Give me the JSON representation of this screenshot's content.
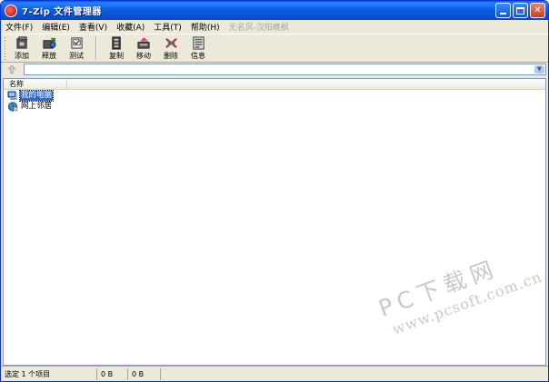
{
  "window": {
    "title": "7-Zip 文件管理器"
  },
  "menubar": {
    "items": [
      "文件(F)",
      "编辑(E)",
      "查看(V)",
      "收藏(A)",
      "工具(T)",
      "帮助(H)"
    ],
    "watermark": "无名风-汉阳晚枫"
  },
  "toolbar": {
    "buttons": [
      {
        "label": "添加",
        "icon": "add-icon"
      },
      {
        "label": "释放",
        "icon": "extract-icon"
      },
      {
        "label": "测试",
        "icon": "test-icon"
      },
      {
        "label": "复制",
        "icon": "copy-icon"
      },
      {
        "label": "移动",
        "icon": "move-icon"
      },
      {
        "label": "删除",
        "icon": "delete-icon"
      },
      {
        "label": "信息",
        "icon": "info-icon"
      }
    ]
  },
  "address": {
    "value": ""
  },
  "list": {
    "column_header": "名称",
    "items": [
      {
        "label": "我的电脑",
        "icon": "computer-icon",
        "selected": true
      },
      {
        "label": "网上邻居",
        "icon": "network-icon",
        "selected": false
      }
    ]
  },
  "watermark": {
    "line1": "PC下载网",
    "line2": "www.pcsoft.com.cn"
  },
  "statusbar": {
    "selection": "选定 1 个项目",
    "size": "0 B",
    "packed": "0 B",
    "extra": ""
  },
  "colors": {
    "titlebar": "#0a5ee5",
    "selection": "#316ac5",
    "face": "#ece9d8"
  }
}
